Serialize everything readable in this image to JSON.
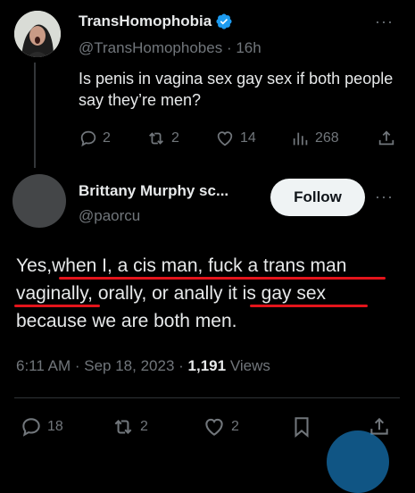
{
  "original_tweet": {
    "display_name": "TransHomophobia",
    "handle": "@TransHomophobes",
    "separator": "·",
    "time": "16h",
    "text": "Is penis in vagina sex gay sex if both people say they’re men?",
    "actions": {
      "replies": "2",
      "retweets": "2",
      "likes": "14",
      "views": "268"
    }
  },
  "reply_tweet": {
    "display_name": "Brittany Murphy sc...",
    "handle": "@paorcu",
    "follow_label": "Follow",
    "text_lines": [
      "Yes,when I, a cis man, fuck a trans man",
      "vaginally, orally, or anally it is gay sex",
      "because we are both men."
    ],
    "time": "6:11 AM",
    "date": "Sep 18, 2023",
    "views_count": "1,191",
    "views_label": "Views",
    "actions": {
      "replies": "18",
      "retweets": "2",
      "likes": "2"
    }
  },
  "colors": {
    "background": "#000000",
    "text": "#e7e9ea",
    "muted": "#71767b",
    "verified": "#1d9bf0",
    "underline": "#e3141b"
  }
}
